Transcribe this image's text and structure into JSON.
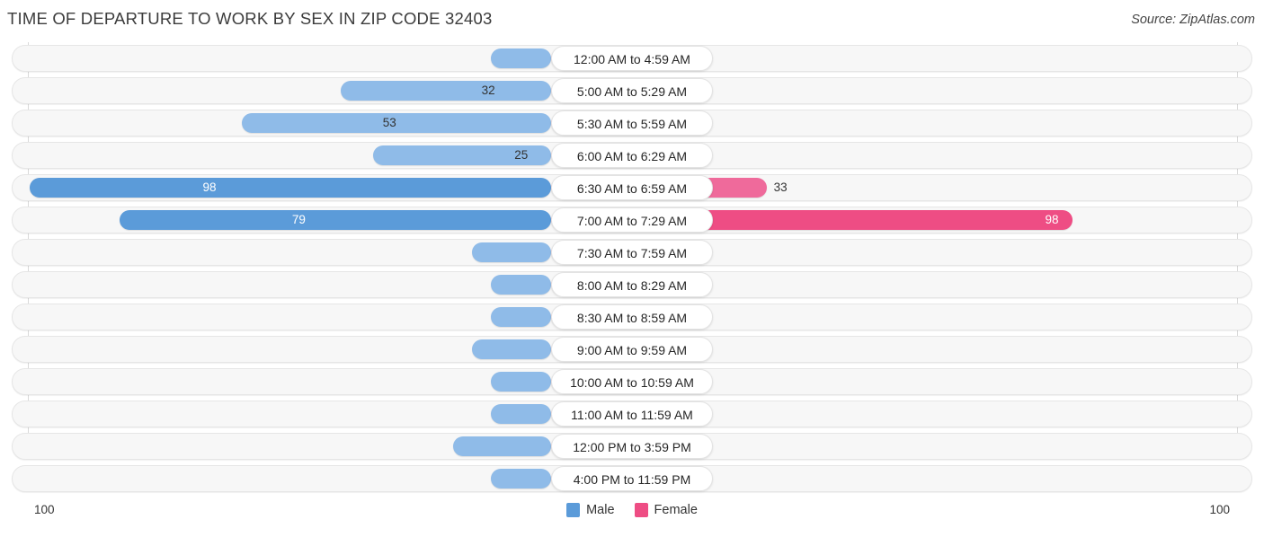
{
  "header": {
    "title": "TIME OF DEPARTURE TO WORK BY SEX IN ZIP CODE 32403",
    "source": "Source: ZipAtlas.com"
  },
  "legend": {
    "male_label": "Male",
    "female_label": "Female",
    "male_color": "#5b9bd9",
    "female_color": "#ee4d84"
  },
  "axis": {
    "left_tick": "100",
    "right_tick": "100"
  },
  "chart_data": {
    "type": "bar",
    "orientation": "horizontal-diverging",
    "title": "TIME OF DEPARTURE TO WORK BY SEX IN ZIP CODE 32403",
    "xlabel": "",
    "ylabel": "",
    "xlim": [
      100,
      100
    ],
    "grid": true,
    "legend_position": "bottom-center",
    "categories": [
      "12:00 AM to 4:59 AM",
      "5:00 AM to 5:29 AM",
      "5:30 AM to 5:59 AM",
      "6:00 AM to 6:29 AM",
      "6:30 AM to 6:59 AM",
      "7:00 AM to 7:29 AM",
      "7:30 AM to 7:59 AM",
      "8:00 AM to 8:29 AM",
      "8:30 AM to 8:59 AM",
      "9:00 AM to 9:59 AM",
      "10:00 AM to 10:59 AM",
      "11:00 AM to 11:59 AM",
      "12:00 PM to 3:59 PM",
      "4:00 PM to 11:59 PM"
    ],
    "series": [
      {
        "name": "Male",
        "values": [
          0,
          32,
          53,
          25,
          98,
          79,
          4,
          0,
          0,
          4,
          0,
          0,
          8,
          0
        ]
      },
      {
        "name": "Female",
        "values": [
          4,
          0,
          0,
          5,
          33,
          98,
          0,
          0,
          0,
          6,
          0,
          0,
          6,
          10
        ]
      }
    ]
  },
  "rows": [
    {
      "label": "12:00 AM to 4:59 AM",
      "male": "0",
      "female": "4",
      "male_val": 0,
      "female_val": 4
    },
    {
      "label": "5:00 AM to 5:29 AM",
      "male": "32",
      "female": "0",
      "male_val": 32,
      "female_val": 0
    },
    {
      "label": "5:30 AM to 5:59 AM",
      "male": "53",
      "female": "0",
      "male_val": 53,
      "female_val": 0
    },
    {
      "label": "6:00 AM to 6:29 AM",
      "male": "25",
      "female": "5",
      "male_val": 25,
      "female_val": 5
    },
    {
      "label": "6:30 AM to 6:59 AM",
      "male": "98",
      "female": "33",
      "male_val": 98,
      "female_val": 33
    },
    {
      "label": "7:00 AM to 7:29 AM",
      "male": "79",
      "female": "98",
      "male_val": 79,
      "female_val": 98
    },
    {
      "label": "7:30 AM to 7:59 AM",
      "male": "4",
      "female": "0",
      "male_val": 4,
      "female_val": 0
    },
    {
      "label": "8:00 AM to 8:29 AM",
      "male": "0",
      "female": "0",
      "male_val": 0,
      "female_val": 0
    },
    {
      "label": "8:30 AM to 8:59 AM",
      "male": "0",
      "female": "0",
      "male_val": 0,
      "female_val": 0
    },
    {
      "label": "9:00 AM to 9:59 AM",
      "male": "4",
      "female": "6",
      "male_val": 4,
      "female_val": 6
    },
    {
      "label": "10:00 AM to 10:59 AM",
      "male": "0",
      "female": "0",
      "male_val": 0,
      "female_val": 0
    },
    {
      "label": "11:00 AM to 11:59 AM",
      "male": "0",
      "female": "0",
      "male_val": 0,
      "female_val": 0
    },
    {
      "label": "12:00 PM to 3:59 PM",
      "male": "8",
      "female": "6",
      "male_val": 8,
      "female_val": 6
    },
    {
      "label": "4:00 PM to 11:59 PM",
      "male": "0",
      "female": "10",
      "male_val": 0,
      "female_val": 10
    }
  ]
}
